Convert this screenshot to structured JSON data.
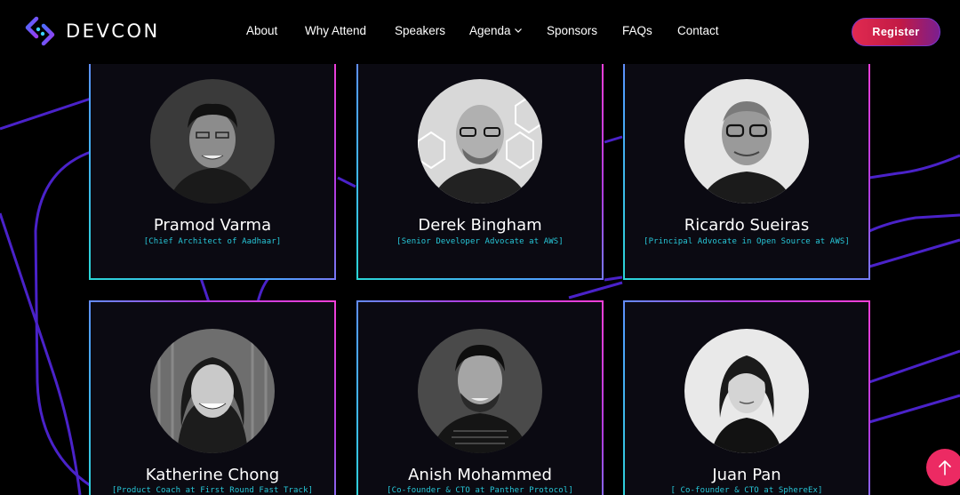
{
  "brand": {
    "name": "DEVCON",
    "logo_icon": "devcon-logo-icon"
  },
  "nav": {
    "items": [
      {
        "label": "About"
      },
      {
        "label": "Why Attend"
      },
      {
        "label": "Speakers"
      },
      {
        "label": "Agenda"
      },
      {
        "label": "Sponsors"
      },
      {
        "label": "FAQs"
      },
      {
        "label": "Contact"
      }
    ],
    "agenda_icon": "chevron-down-icon",
    "register_label": "Register"
  },
  "speakers": [
    {
      "name": "Pramod Varma",
      "role": "[Chief Architect of Aadhaar]"
    },
    {
      "name": "Derek Bingham",
      "role": "[Senior Developer Advocate at AWS]"
    },
    {
      "name": "Ricardo Sueiras",
      "role": "[Principal Advocate in Open Source at AWS]"
    },
    {
      "name": "Katherine Chong",
      "role": "[Product Coach at First Round Fast Track]"
    },
    {
      "name": "Anish Mohammed",
      "role": "[Co-founder & CTO at Panther Protocol]"
    },
    {
      "name": "Juan Pan",
      "role": "[ Co-founder & CTO at SphereEx]"
    }
  ],
  "scroll_top_icon": "arrow-up-icon",
  "colors": {
    "accent": "#ec2a63",
    "role_text": "#27c7d8",
    "card_border_start": "#2ad6d6",
    "card_border_end": "#f23fd8",
    "background_lines": "#4a22c9"
  }
}
